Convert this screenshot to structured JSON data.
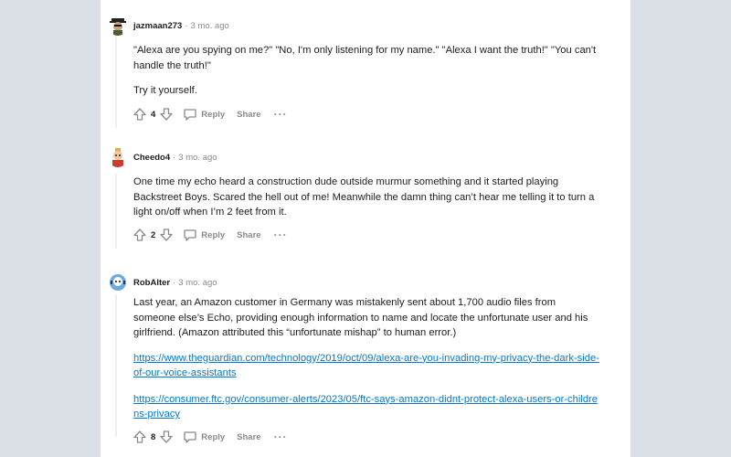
{
  "comments": [
    {
      "author": "jazmaan273",
      "time": "3 mo. ago",
      "paragraphs": [
        "\"Alexa are you spying on me?\" \"No, I'm only listening for my name.\" \"Alexa I want the truth!\" \"You can't handle the truth!\"",
        "Try it yourself."
      ],
      "links": [],
      "score": "4"
    },
    {
      "author": "Cheedo4",
      "time": "3 mo. ago",
      "paragraphs": [
        "One time my echo heard a construction dude outside murmur something and it started playing Backstreet Boys. Scared the hell out of me! Meanwhile the damn thing can’t hear me telling it to turn a light on/off when I’m 2 feet from it."
      ],
      "links": [],
      "score": "2"
    },
    {
      "author": "RobAlter",
      "time": "3 mo. ago",
      "paragraphs": [
        "Last year, an Amazon customer in Germany was mistakenly sent about 1,700 audio files from someone else’s Echo, providing enough information to name and locate the unfortunate user and his girlfriend. (Amazon attributed this “unfortunate mishap” to human error.)"
      ],
      "links": [
        "https://www.theguardian.com/technology/2019/oct/09/alexa-are-you-invading-my-privacy-the-dark-side-of-our-voice-assistants",
        "https://consumer.ftc.gov/consumer-alerts/2023/05/ftc-says-amazon-didnt-protect-alexa-users-or-childrens-privacy"
      ],
      "score": "8"
    }
  ],
  "actions": {
    "separator": "·",
    "reply_label": "Reply",
    "share_label": "Share",
    "more_label": "···"
  },
  "icons": {
    "upvote": "upvote-arrow-icon",
    "downvote": "downvote-arrow-icon",
    "reply": "speech-bubble-icon"
  },
  "colors": {
    "page_bg": "#dae0e6",
    "card_bg": "#ffffff",
    "link": "#0079d3",
    "meta": "#878a8c"
  }
}
